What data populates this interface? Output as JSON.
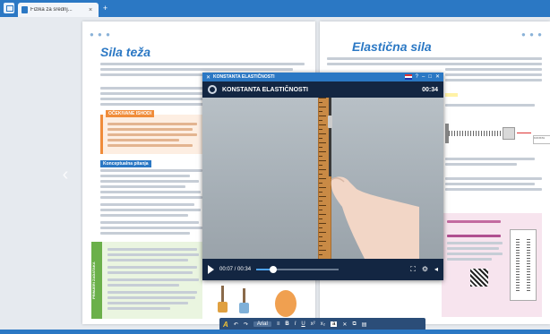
{
  "tabbar": {
    "tab_label": "Fizika za srednj...",
    "tab_close": "×",
    "new_tab": "+"
  },
  "left_page": {
    "title": "Sila teža",
    "orange_header": "OČEKIVANE ISHODI",
    "blue_header": "Konceptualna pitanja",
    "green_side_label": "PRIMJERI ZADATAKA"
  },
  "right_page": {
    "title": "Elastična sila"
  },
  "player": {
    "window_title": "KONSTANTA ELASTIČNOSTI",
    "header_title": "KONSTANTA ELASTIČNOSTI",
    "header_time": "00:34",
    "current_time": "00:07 / 00:34",
    "progress_fraction": 0.21
  },
  "toolbar": {
    "font_label": "A",
    "select_label": "Arial",
    "bold": "B",
    "italic": "I",
    "underline": "U"
  },
  "colors": {
    "accent": "#2b78c4",
    "orange": "#f08c3a",
    "green": "#6bb04a"
  }
}
